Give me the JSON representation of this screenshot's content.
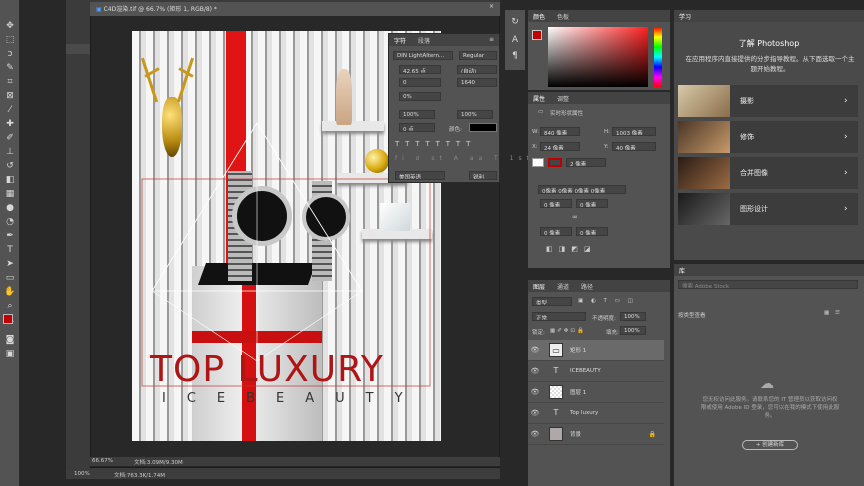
{
  "document": {
    "tab_title": "C4D渲染.tif @ 66.7% (矩形 1, RGB/8) *",
    "zoom": "66.67%",
    "doc_info": "文档:3.09M/9.30M",
    "zoom2": "100%",
    "doc_info2": "文档:763.3K/1.74M"
  },
  "poster": {
    "title": "TOP LUXURY",
    "subtitle": "ICEBEAUTY"
  },
  "character": {
    "tabs": [
      "字符",
      "段落"
    ],
    "font": "DIN LightAltern...",
    "style": "Regular",
    "size": "42.65 点",
    "leading": "(自动)",
    "kerning": "0",
    "tracking": "1640",
    "vscale": "0%",
    "hscale": "100%",
    "vert": "100%",
    "baseline": "0 点",
    "color_label": "颜色:",
    "language": "美国英语",
    "aa": "锐利"
  },
  "color": {
    "tabs": [
      "颜色",
      "色板"
    ]
  },
  "properties": {
    "tabs": [
      "属性",
      "调整"
    ],
    "kind": "实时形状属性",
    "w_label": "W:",
    "w": "840 像素",
    "h_label": "H:",
    "h": "1003 像素",
    "x_label": "X:",
    "x": "24 像素",
    "y_label": "Y:",
    "y": "40 像素",
    "stroke": "2 像素",
    "corners": "0像素 0像素 0像素 0像素",
    "c1": "0 像素",
    "c2": "0 像素",
    "c3": "0 像素",
    "c4": "0 像素"
  },
  "layers": {
    "tabs": [
      "图层",
      "通道",
      "路径"
    ],
    "filter": "类型",
    "blend": "正常",
    "opacity_label": "不透明度:",
    "opacity": "100%",
    "lock_label": "锁定:",
    "fill_label": "填充:",
    "fill": "100%",
    "items": [
      {
        "name": "矩形 1",
        "kind": "shape"
      },
      {
        "name": "ICEBEAUTY",
        "kind": "text"
      },
      {
        "name": "图层 1",
        "kind": "pixel"
      },
      {
        "name": "Top luxury",
        "kind": "text"
      },
      {
        "name": "背景",
        "kind": "bg"
      }
    ]
  },
  "learn": {
    "tab": "学习",
    "heading": "了解 Photoshop",
    "desc": "在应用程序内直接提供的分步指导教程。从下面选取一个主题开始教程。",
    "items": [
      "摄影",
      "修饰",
      "合并图像",
      "图形设计"
    ]
  },
  "library": {
    "tab": "库",
    "search_placeholder": "搜索 Adobe Stock",
    "view": "按类型查看",
    "notice": "您无权访问此服务。请联系您的 IT 管理员以获取访问权限或使用 Adobe ID 登录，您可以在我的模式下使用此服务。",
    "create": "+ 创建新库"
  }
}
